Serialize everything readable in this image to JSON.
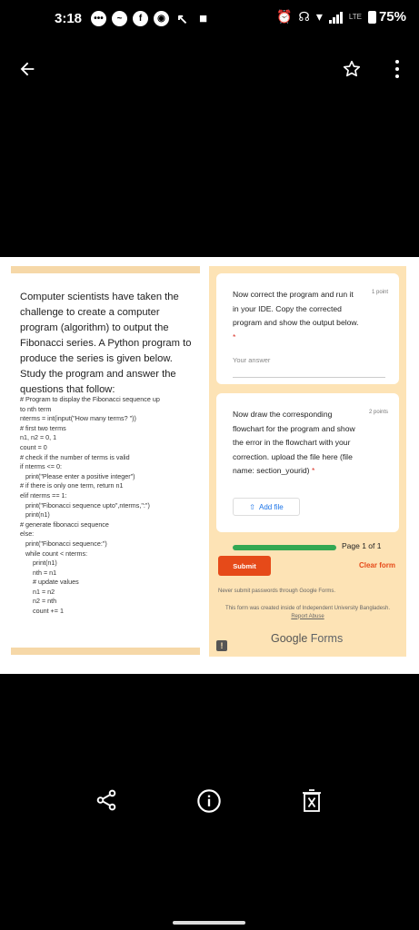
{
  "status_bar": {
    "time": "3:18",
    "lte": "LTE",
    "battery": "75%"
  },
  "form_left": {
    "intro": "Computer scientists have taken the challenge to create a computer program (algorithm) to output the Fibonacci series. A Python program to produce the series is given below. Study the program and answer the questions that follow:",
    "code": "# Program to display the Fibonacci sequence up\nto nth term\nnterms = int(input(\"How many terms? \"))\n# first two terms\nn1, n2 = 0, 1\ncount = 0\n# check if the number of terms is valid\nif nterms <= 0:\n   print(\"Please enter a positive integer\")\n# if there is only one term, return n1\nelif nterms == 1:\n   print(\"Fibonacci sequence upto\",nterms,\":\")\n   print(n1)\n# generate fibonacci sequence\nelse:\n   print(\"Fibonacci sequence:\")\n   while count < nterms:\n       print(n1)\n       nth = n1\n       # update values\n       n1 = n2\n       n2 = nth\n       count += 1"
  },
  "form_right": {
    "q1": {
      "text": "Now correct the program and run it in your IDE. Copy the corrected program and show the output below.",
      "required": "*",
      "points": "1 point",
      "placeholder": "Your answer"
    },
    "q2": {
      "text": "Now draw the corresponding flowchart for the program and show the error in the flowchart with your correction. upload the file here (file name: section_yourid)",
      "required": "*",
      "points": "2 points",
      "add_file": "Add file"
    },
    "progress_fraction": 1.0,
    "page_indicator": "Page 1 of 1",
    "submit": "Submit",
    "clear": "Clear form",
    "never_submit": "Never submit passwords through Google Forms.",
    "created_by": "This form was created inside of Independent University Bangladesh.",
    "report_abuse": "Report Abuse",
    "brand_google": "Google",
    "brand_forms": "Forms"
  },
  "colors": {
    "accent": "#e64a19",
    "form_bg": "#fde3b5",
    "progress": "#34a853"
  }
}
